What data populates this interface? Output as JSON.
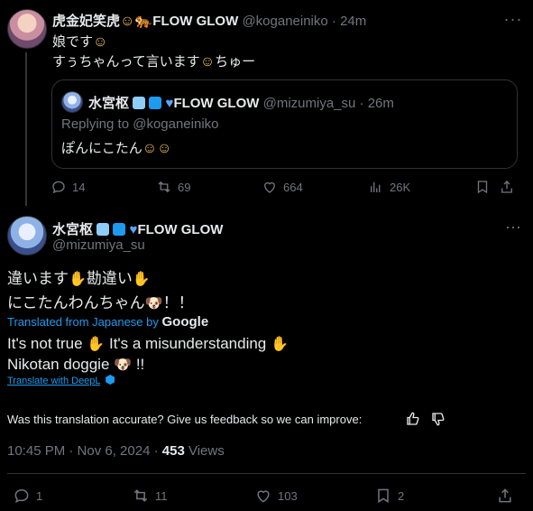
{
  "tweet1": {
    "display_name": "虎金妃笑虎",
    "name_suffix": "FLOW GLOW",
    "handle": "@koganeiniko",
    "time": "24m",
    "line1": "娘です",
    "line2": "すぅちゃんって言います",
    "line2_tail": "ちゅー",
    "quote": {
      "display_name": "水宮枢",
      "name_suffix": "FLOW GLOW",
      "handle": "@mizumiya_su",
      "time": "26m",
      "replying": "Replying to @koganeiniko",
      "text": "ぽんにこたん"
    },
    "actions": {
      "replies": "14",
      "reposts": "69",
      "likes": "664",
      "views": "26K"
    }
  },
  "tweet2": {
    "display_name": "水宮枢",
    "name_suffix": "FLOW GLOW",
    "handle": "@mizumiya_su",
    "line1a": "違います",
    "line1b": "勘違い",
    "line2a": "にこたんわんちゃん",
    "line2b": "！！",
    "translated_from": "Translated from Japanese by",
    "google": "Google",
    "trans1a": "It's not true",
    "trans1b": "It's a misunderstanding",
    "trans2a": "Nikotan doggie",
    "trans2b": "!!",
    "translate_with": "Translate with DeepL",
    "feedback": "Was this translation accurate? Give us feedback so we can improve:",
    "timestamp": "10:45 PM · Nov 6, 2024 ·",
    "views_count": "453",
    "views_label": "Views",
    "actions": {
      "replies": "1",
      "reposts": "11",
      "likes": "103",
      "bookmarks": "2"
    }
  },
  "colors": {
    "accent": "#1d9bf0",
    "muted": "#71767b",
    "divider": "#2f3336",
    "background": "#000000"
  },
  "emoji": {
    "smile": "☺",
    "hand": "✋",
    "dog": "🐶",
    "tiger": "🐅"
  }
}
